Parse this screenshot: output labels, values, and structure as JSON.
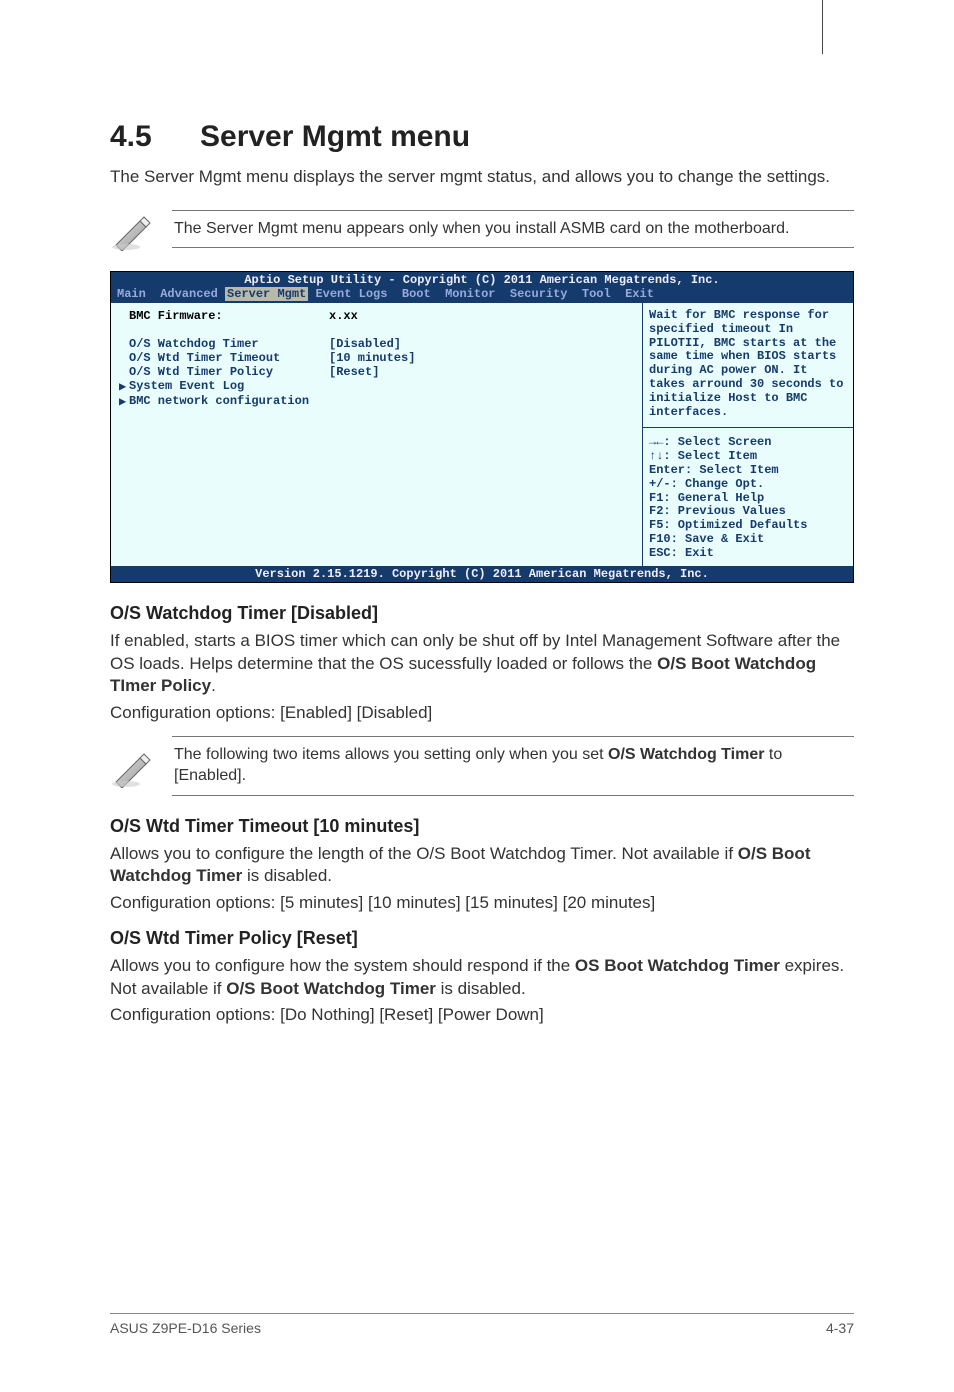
{
  "section": {
    "number": "4.5",
    "title": "Server Mgmt menu"
  },
  "intro": "The Server Mgmt menu displays the server mgmt status, and allows you to change the settings.",
  "note1": "The Server Mgmt menu appears only when you install ASMB card on the motherboard.",
  "bios": {
    "header": "Aptio Setup Utility - Copyright (C) 2011 American Megatrends, Inc.",
    "tabs": {
      "pre": "Main  Advanced ",
      "active": "Server Mgmt",
      "post": " Event Logs  Boot  Monitor  Security  Tool  Exit"
    },
    "rows": [
      {
        "style": "black",
        "tri": "",
        "label": "BMC Firmware:",
        "value": "x.xx"
      },
      {
        "style": "blank",
        "tri": "",
        "label": "",
        "value": ""
      },
      {
        "style": "blue",
        "tri": "",
        "label": "O/S Watchdog Timer",
        "value": "[Disabled]"
      },
      {
        "style": "blue",
        "tri": "",
        "label": "O/S Wtd Timer Timeout",
        "value": "[10 minutes]"
      },
      {
        "style": "blue",
        "tri": "",
        "label": "O/S Wtd Timer Policy",
        "value": "[Reset]"
      },
      {
        "style": "blue",
        "tri": "▶",
        "label": "System Event Log",
        "value": ""
      },
      {
        "style": "blue",
        "tri": "▶",
        "label": "BMC network configuration",
        "value": ""
      }
    ],
    "help": "Wait for BMC response for specified timeout In PILOTII, BMC starts at the same time when BIOS starts during AC power ON. It takes arround 30 seconds to initialize Host to BMC interfaces.",
    "keys": [
      "→←: Select Screen",
      "↑↓:  Select Item",
      "Enter: Select Item",
      "+/-: Change Opt.",
      "F1: General Help",
      "F2: Previous Values",
      "F5: Optimized Defaults",
      "F10: Save & Exit",
      "ESC: Exit"
    ],
    "footer": "Version 2.15.1219. Copyright (C) 2011 American Megatrends, Inc."
  },
  "sub1": {
    "title": "O/S Watchdog Timer [Disabled]",
    "p1a": "If enabled, starts a BIOS timer which can only be shut off by Intel Management Software after the OS loads. Helps determine that the OS sucessfully loaded or follows the ",
    "p1b": "O/S Boot Watchdog TImer Policy",
    "p1c": ".",
    "opts": "Configuration options: [Enabled] [Disabled]"
  },
  "note2a": "The following two items allows you setting only when you set ",
  "note2b": "O/S Watchdog Timer",
  "note2c": " to [Enabled].",
  "sub2": {
    "title": "O/S Wtd Timer Timeout [10 minutes]",
    "p1a": "Allows you to configure the length of the O/S Boot Watchdog Timer. Not available if ",
    "p1b": "O/S Boot Watchdog Timer",
    "p1c": " is disabled.",
    "opts": "Configuration options: [5 minutes] [10 minutes] [15 minutes] [20 minutes]"
  },
  "sub3": {
    "title": "O/S Wtd Timer Policy [Reset]",
    "p1a": "Allows you to configure how the system should respond if the ",
    "p1b": "OS Boot Watchdog Timer",
    "p1c": " expires. Not available if ",
    "p1d": "O/S Boot Watchdog Timer",
    "p1e": " is disabled.",
    "opts": "Configuration options: [Do Nothing] [Reset] [Power Down]"
  },
  "footer": {
    "left": "ASUS Z9PE-D16 Series",
    "right": "4-37"
  }
}
